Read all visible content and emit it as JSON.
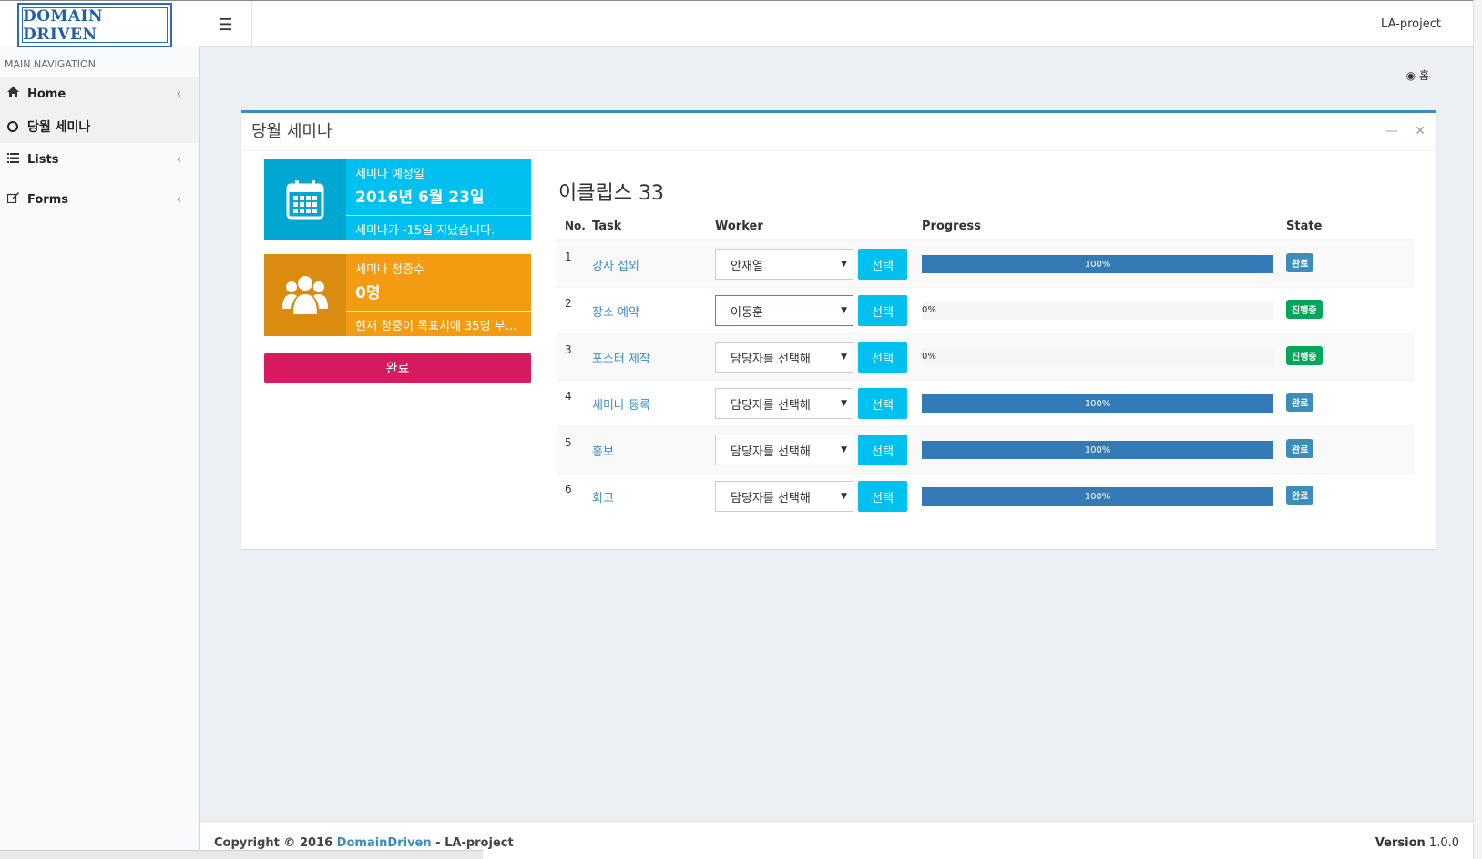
{
  "app": {
    "logo_text": "DOMAIN DRIVEN",
    "project_name": "LA-project"
  },
  "sidebar": {
    "header": "MAIN NAVIGATION",
    "items": [
      {
        "label": "Home",
        "icon": "home-icon"
      },
      {
        "label": "당월 세미나",
        "icon": "circle-icon"
      },
      {
        "label": "Lists",
        "icon": "list-icon"
      },
      {
        "label": "Forms",
        "icon": "edit-icon"
      }
    ]
  },
  "breadcrumb": {
    "icon": "dashboard-icon",
    "label": "홈"
  },
  "box": {
    "title": "당월 세미나",
    "collapse_icon": "minus-icon",
    "close_icon": "close-icon"
  },
  "info1": {
    "text": "세미나 예정일",
    "number": "2016년 6월 23일",
    "desc": "세미나가 -15일 지났습니다.",
    "icon": "calendar-icon",
    "color": "#00c0ef"
  },
  "info2": {
    "text": "세미나 청중수",
    "number": "0명",
    "desc": "현재 청중이 목표치에 35명 부...",
    "icon": "users-icon",
    "color": "#f39c12"
  },
  "done_button": "완료",
  "table": {
    "title": "이클립스 33",
    "headers": {
      "no": "No.",
      "task": "Task",
      "worker": "Worker",
      "progress": "Progress",
      "state": "State"
    },
    "select_label": "선택",
    "rows": [
      {
        "no": "1",
        "task": "강사 섭외",
        "worker": "안재열",
        "progress": 100,
        "progress_label": "100%",
        "state": "완료"
      },
      {
        "no": "2",
        "task": "장소 예약",
        "worker": "이동훈",
        "progress": 0,
        "progress_label": "0%",
        "state": "진행중"
      },
      {
        "no": "3",
        "task": "포스터 제작",
        "worker": "담당자를 선택해",
        "progress": 0,
        "progress_label": "0%",
        "state": "진행중"
      },
      {
        "no": "4",
        "task": "세미나 등록",
        "worker": "담당자를 선택해",
        "progress": 100,
        "progress_label": "100%",
        "state": "완료"
      },
      {
        "no": "5",
        "task": "홍보",
        "worker": "담당자를 선택해",
        "progress": 100,
        "progress_label": "100%",
        "state": "완료"
      },
      {
        "no": "6",
        "task": "회고",
        "worker": "담당자를 선택해",
        "progress": 100,
        "progress_label": "100%",
        "state": "완료"
      }
    ]
  },
  "footer": {
    "copyright_prefix": "Copyright © 2016",
    "link": "DomainDriven",
    "copyright_suffix": "- LA-project",
    "version_label": "Version",
    "version": "1.0.0"
  }
}
